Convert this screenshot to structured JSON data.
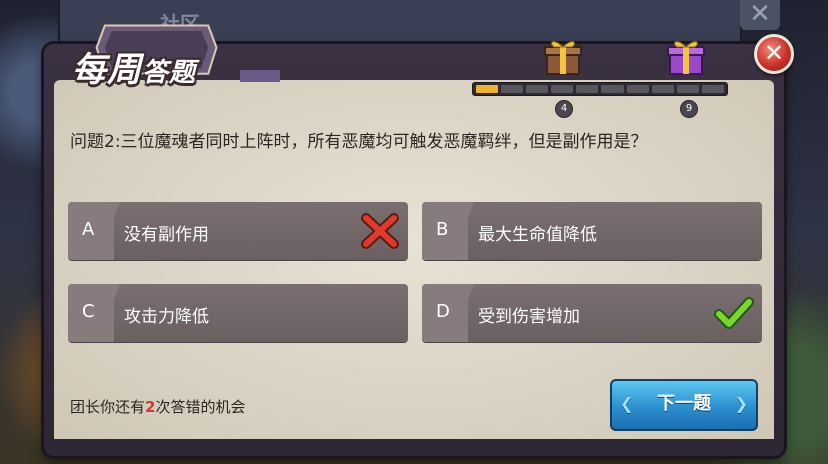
{
  "background": {
    "tab_title": "社区",
    "close_symbol": "✕"
  },
  "dialog": {
    "title_main": "每周",
    "title_sub": "答题",
    "close_symbol": "✕"
  },
  "progress": {
    "segments_total": 10,
    "segments_done": 1,
    "rewards": [
      {
        "at": "4",
        "icon": "gift-box-gold"
      },
      {
        "at": "9",
        "icon": "gift-box-purple"
      }
    ]
  },
  "question": "问题2:三位魔魂者同时上阵时，所有恶魔均可触发恶魔羁绊，但是副作用是？",
  "answers": [
    {
      "letter": "A",
      "text": "没有副作用",
      "mark": "wrong"
    },
    {
      "letter": "B",
      "text": "最大生命值降低",
      "mark": ""
    },
    {
      "letter": "C",
      "text": "攻击力降低",
      "mark": ""
    },
    {
      "letter": "D",
      "text": "受到伤害增加",
      "mark": "correct"
    }
  ],
  "chances": {
    "prefix": "团长你还有",
    "count": "2",
    "suffix": "次答错的机会"
  },
  "next_button": "下一题",
  "colors": {
    "accent_red": "#d03a2a",
    "progress_gold": "#f0b030",
    "button_blue": "#2a8fd0"
  }
}
